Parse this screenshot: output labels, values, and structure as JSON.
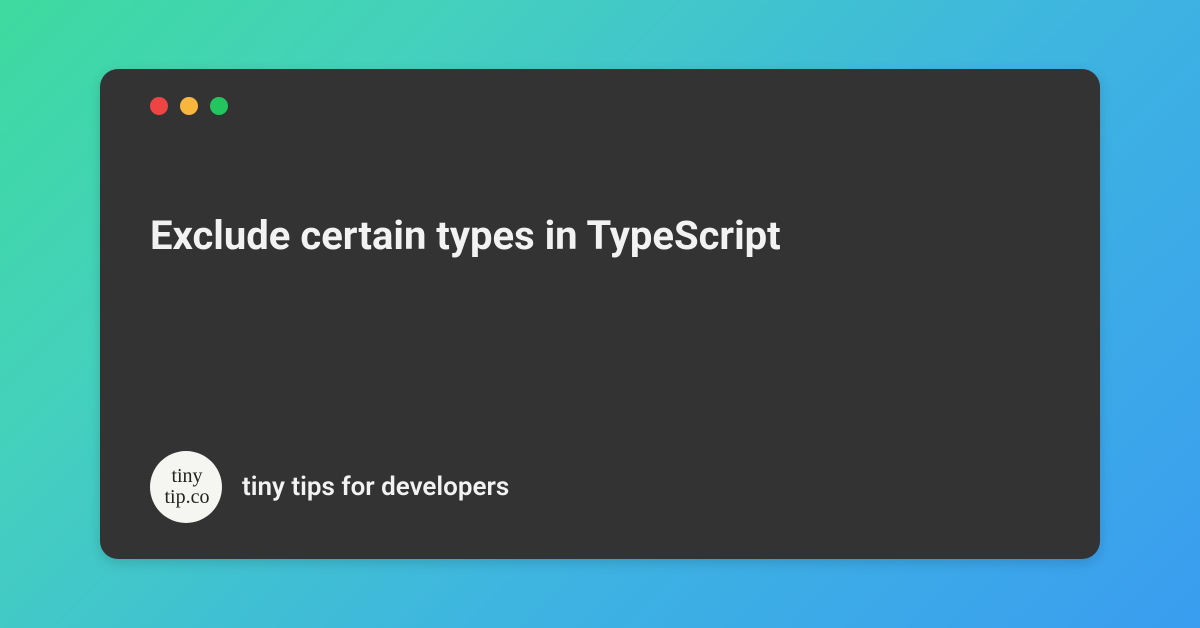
{
  "colors": {
    "window_bg": "#333333",
    "text": "#f2f2f2",
    "traffic_red": "#ef4444",
    "traffic_yellow": "#f6b73c",
    "traffic_green": "#22c55e",
    "gradient_start": "#3eda9f",
    "gradient_end": "#3a9df0"
  },
  "title": "Exclude certain types in TypeScript",
  "logo": {
    "line1": "tiny",
    "line2": "tip.co"
  },
  "tagline": "tiny tips for developers"
}
